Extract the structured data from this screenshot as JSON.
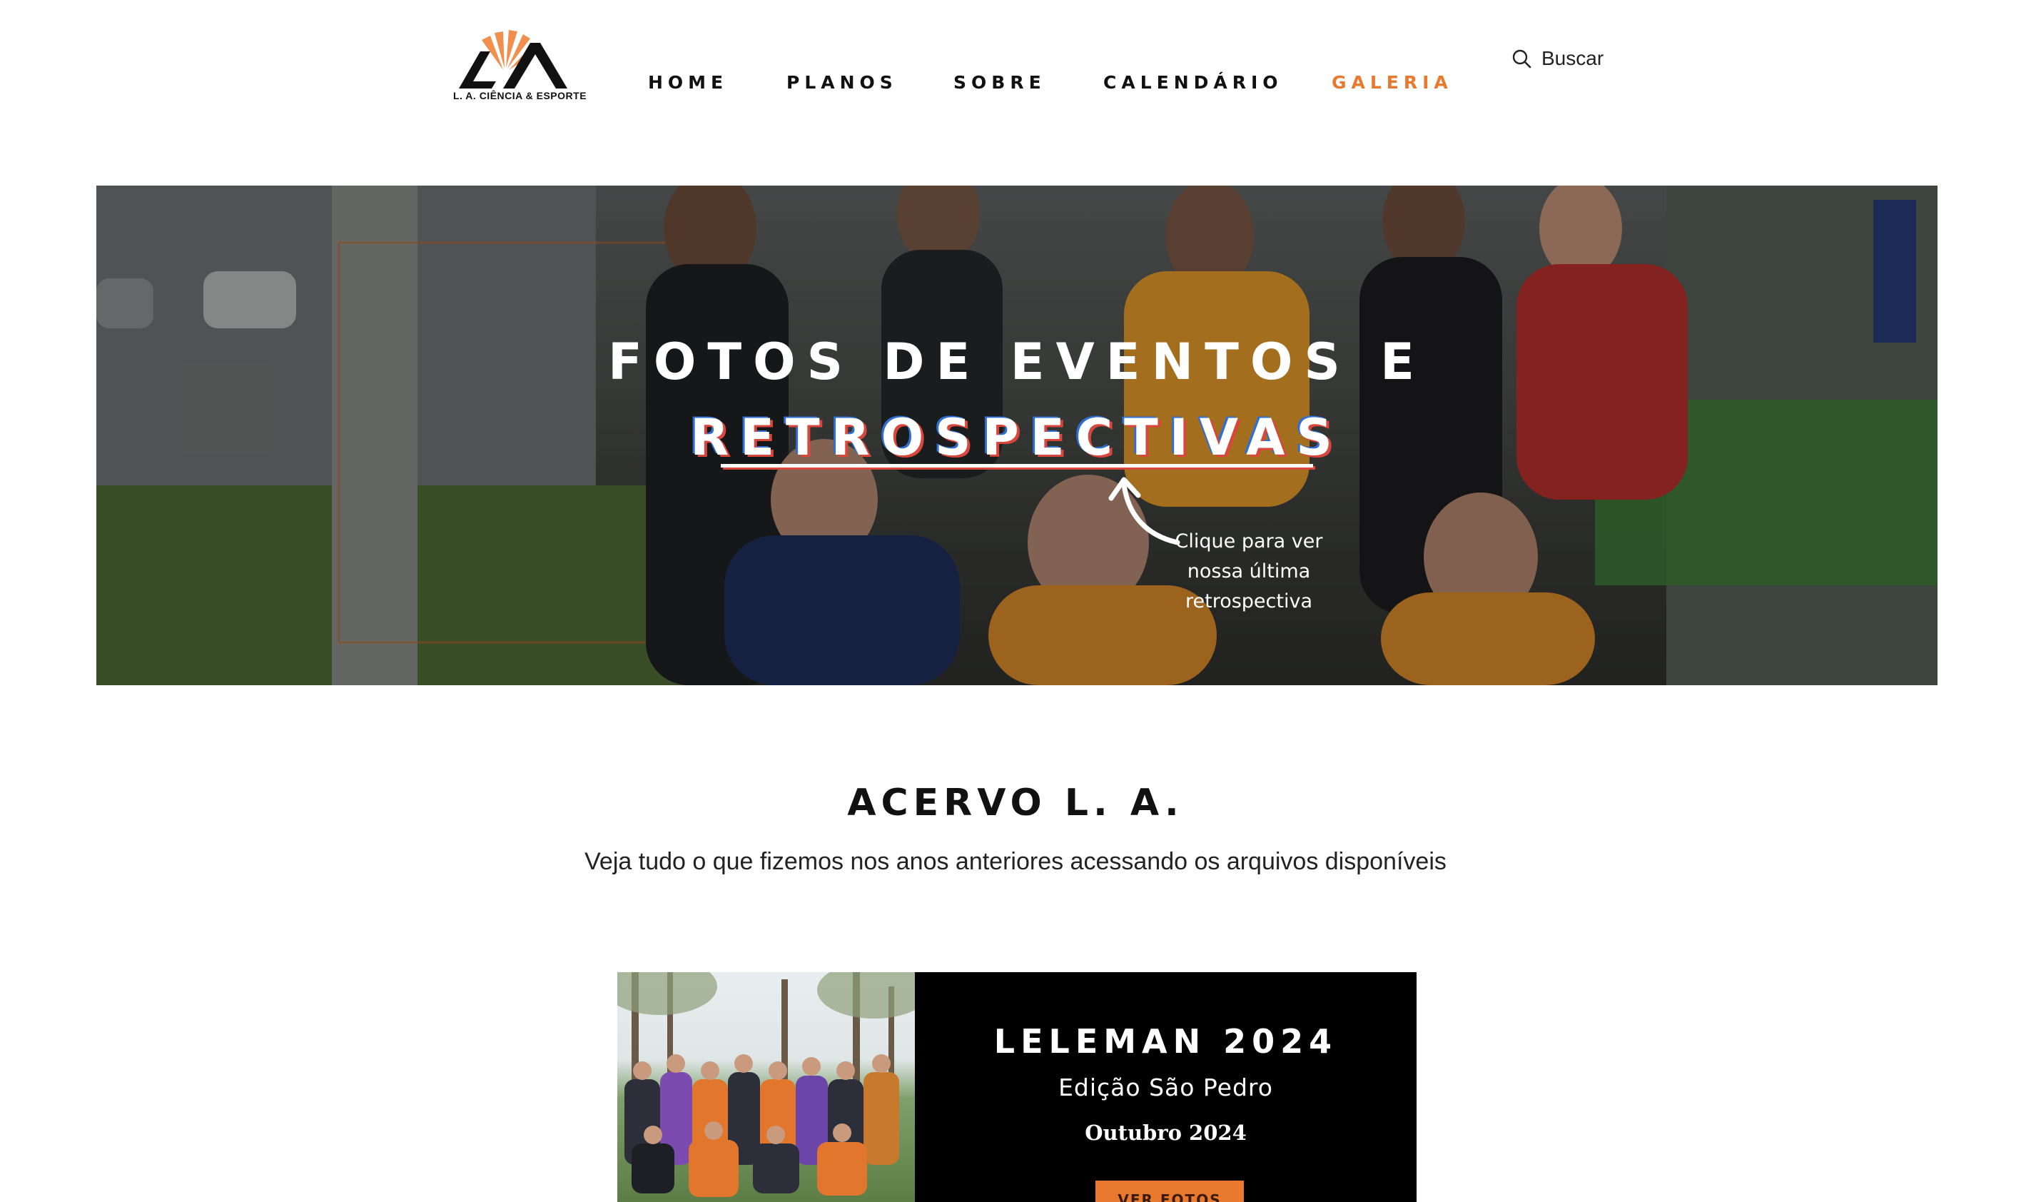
{
  "brand": {
    "logo_text": "L. A. CIÊNCIA & ESPORTE",
    "accent_color": "#e8792f"
  },
  "nav": {
    "items": [
      {
        "label": "HOME",
        "active": false
      },
      {
        "label": "PLANOS",
        "active": false
      },
      {
        "label": "SOBRE",
        "active": false
      },
      {
        "label": "CALENDÁRIO",
        "active": false
      },
      {
        "label": "GALERIA",
        "active": true
      }
    ]
  },
  "search": {
    "label": "Buscar",
    "icon": "search-icon"
  },
  "hero": {
    "title_line1": "FOTOS DE EVENTOS E",
    "title_line2": "RETROSPECTIVAS",
    "cta_line1": "Clique para ver",
    "cta_line2": "nossa última",
    "cta_line3": "retrospectiva",
    "arrow_icon": "curved-arrow-up-icon"
  },
  "section": {
    "title": "ACERVO L. A.",
    "subtitle": "Veja tudo o que fizemos nos anos anteriores acessando os arquivos disponíveis"
  },
  "card": {
    "title": "LELEMAN 2024",
    "subtitle": "Edição São Pedro",
    "date": "Outubro 2024",
    "button_label": "VER FOTOS"
  }
}
